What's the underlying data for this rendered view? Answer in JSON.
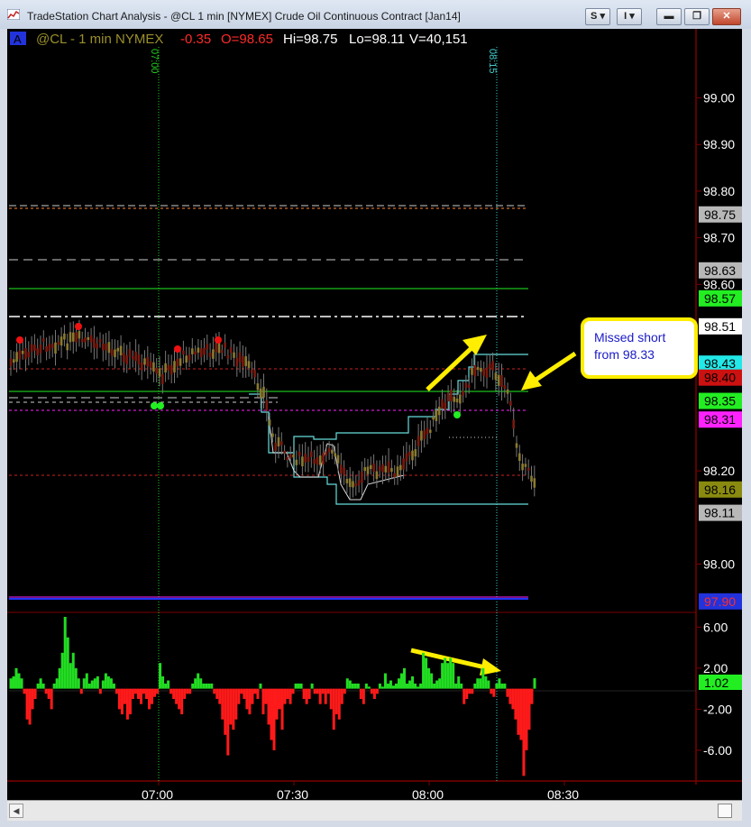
{
  "window": {
    "title": "TradeStation Chart Analysis - @CL 1 min [NYMEX] Crude Oil Continuous Contract [Jan14]",
    "buttons": {
      "s_label": "S",
      "i_label": "I"
    }
  },
  "header": {
    "badge": "A",
    "symbol": "@CL - 1 min  NYMEX",
    "change": "-0.35",
    "open": "O=98.65",
    "high": "Hi=98.75",
    "low": "Lo=98.11",
    "volume": "V=40,151"
  },
  "colors": {
    "background": "#000000",
    "text": "#ffffff",
    "symbol": "#9a8f2a",
    "down": "#ff2a2a",
    "up_bar": "#22dd22",
    "down_bar": "#ff1a1a",
    "cyan": "#66dddd",
    "annotation_border": "#ffff00",
    "annotation_text": "#1a1ac8"
  },
  "time_markers": [
    "07:00",
    "08:15"
  ],
  "annotation": {
    "text_line1": "Missed short",
    "text_line2": "from 98.33"
  },
  "chart_data": [
    {
      "type": "line",
      "x_axis_labels": [
        "07:00",
        "07:30",
        "08:00",
        "08:30"
      ],
      "y_axis": {
        "ticks": [
          "99.00",
          "98.90",
          "98.80",
          "98.70",
          "98.60",
          "98.20",
          "98.00"
        ],
        "ylim": [
          97.91,
          99.09
        ]
      },
      "price_tags": [
        {
          "label": "98.75",
          "value": 98.75,
          "bg": "#b8b8b8",
          "fg": "#000000"
        },
        {
          "label": "98.63",
          "value": 98.63,
          "bg": "#b8b8b8",
          "fg": "#000000"
        },
        {
          "label": "98.57",
          "value": 98.57,
          "bg": "#22ee22",
          "fg": "#000000"
        },
        {
          "label": "98.51",
          "value": 98.51,
          "bg": "#ffffff",
          "fg": "#000000"
        },
        {
          "label": "98.43",
          "value": 98.43,
          "bg": "#22e8e8",
          "fg": "#000000"
        },
        {
          "label": "98.40",
          "value": 98.4,
          "bg": "#cc1111",
          "fg": "#000000"
        },
        {
          "label": "98.35",
          "value": 98.35,
          "bg": "#22ee22",
          "fg": "#000000"
        },
        {
          "label": "98.31",
          "value": 98.31,
          "bg": "#ff22ff",
          "fg": "#000000"
        },
        {
          "label": "98.16",
          "value": 98.16,
          "bg": "#8a8a10",
          "fg": "#000000"
        },
        {
          "label": "98.11",
          "value": 98.11,
          "bg": "#b8b8b8",
          "fg": "#000000"
        },
        {
          "label": "97.90",
          "value": 97.92,
          "bg": "#2233dd",
          "fg": "#ff2a2a"
        }
      ]
    },
    {
      "type": "bar",
      "y_axis": {
        "ticks": [
          "6.00",
          "2.00",
          "-2.00",
          "-6.00"
        ],
        "ylim": [
          -9,
          7
        ]
      },
      "last_value_label": "1.02",
      "last_value": 1.02,
      "values": [
        1,
        1.2,
        2,
        1.5,
        1,
        -0.5,
        -3,
        -3.5,
        -2,
        -1,
        0.5,
        1,
        0.5,
        -0.5,
        -1,
        -2,
        0.5,
        1,
        2,
        3.5,
        7,
        5,
        2.5,
        3.5,
        2,
        1,
        -0.5,
        1,
        1.5,
        0.5,
        0.8,
        1,
        1.2,
        -0.5,
        0.8,
        1.5,
        1.2,
        1,
        0.5,
        -0.5,
        -2,
        -2.5,
        -1.5,
        -3,
        -2.5,
        -1,
        -0.5,
        -1,
        -1.5,
        -0.5,
        -1,
        -2,
        -1.5,
        -0.8,
        -0.5,
        2.5,
        1.2,
        0.5,
        0.8,
        -0.5,
        -1,
        -1.5,
        -2,
        -2.5,
        -1,
        -0.5,
        -0.5,
        0.5,
        1,
        1.5,
        1,
        0.5,
        0.5,
        0.5,
        0.5,
        -0.5,
        -1,
        -1.5,
        -3,
        -4.5,
        -6.5,
        -3.5,
        -4,
        -3,
        -1.5,
        -0.5,
        -1,
        -2,
        -2.5,
        -1.5,
        -0.5,
        -1,
        0.5,
        -2.5,
        -1.5,
        -3.5,
        -5,
        -6,
        -3,
        -2,
        -4,
        -1.5,
        -1,
        -1.5,
        -0.5,
        0.5,
        0.5,
        0.5,
        -1,
        -1.5,
        -1,
        0.5,
        -0.5,
        -0.5,
        -1.5,
        -0.5,
        -1.5,
        -0.5,
        -2,
        -4,
        -2.5,
        -3,
        -1.5,
        -0.5,
        1,
        0.8,
        0.5,
        0.5,
        0.5,
        -1,
        -1.5,
        0.5,
        0.2,
        -0.5,
        -1,
        -0.5,
        0.5,
        0.2,
        1.5,
        0.5,
        0.8,
        0.3,
        0.5,
        1,
        1.5,
        2,
        0.5,
        0.8,
        1.2,
        0.5,
        0.2,
        0.5,
        3.5,
        3,
        2,
        1.5,
        0.5,
        0.8,
        1,
        2.5,
        3,
        2.5,
        3,
        2.5,
        0.5,
        1.2,
        0.5,
        -1.5,
        -1,
        -0.5,
        -0.5,
        0.5,
        1,
        1,
        2,
        1.2,
        0.8,
        -0.5,
        -0.8,
        0.5,
        1,
        0.5,
        0.5,
        -0.8,
        -1.5,
        -2,
        -3,
        -4.5,
        -5,
        -8.5,
        -6,
        -4,
        -1.5,
        1.02
      ]
    }
  ]
}
